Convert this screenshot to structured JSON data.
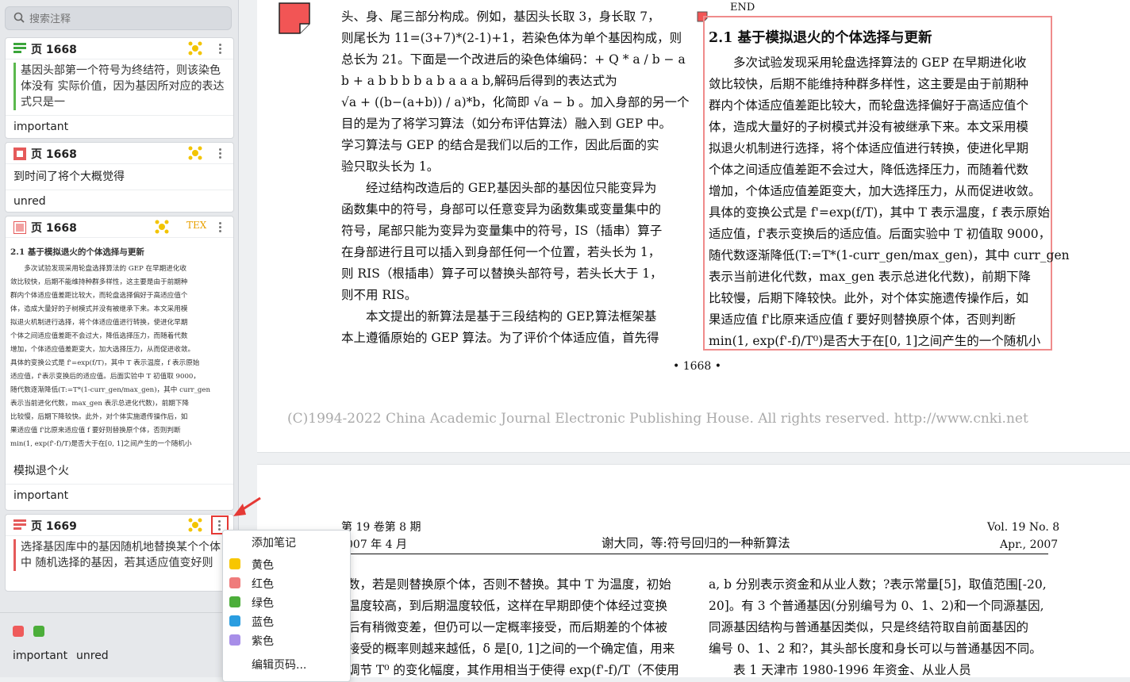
{
  "sidebar": {
    "search_placeholder": "搜索注释",
    "cards": [
      {
        "page": "页 1668",
        "quote": "基因头部第一个符号为终结符，则该染色体没有 实际价值，因为基因所对应的表达式只是一",
        "tag": "important"
      },
      {
        "page": "页 1668",
        "note": "到时间了将个大概觉得",
        "tag": "unred"
      },
      {
        "page": "页 1668",
        "tex": "TEX",
        "note": "模拟退个火",
        "tag": "important",
        "thumb_title": "2.1  基于模拟退火的个体选择与更新",
        "thumb_lines": [
          "多次试验发现采用轮盘选择算法的 GEP 在早期进化收",
          "敛比较快，后期不能维持种群多样性，这主要是由于前期种",
          "群内个体适应值差距比较大，而轮盘选择偏好于高适应值个",
          "体，造成大量好的子树模式并没有被继承下来。本文采用模",
          "拟退火机制进行选择，将个体适应值进行转换，使进化早期",
          "个体之间适应值差距不会过大，降低选择压力，而随着代数",
          "增加，个体适应值差距变大，加大选择压力，从而促进收敛。",
          "具体的变换公式是 f'=exp(f/T)，其中 T 表示温度，f 表示原始",
          "适应值，f'表示变换后的适应值。后面实验中 T 初值取 9000，",
          "随代数逐渐降低(T:=T*(1-curr_gen/max_gen)，其中 curr_gen",
          "表示当前进化代数，max_gen 表示总进化代数)，前期下降",
          "比较慢，后期下降较快。此外，对个体实施遗传操作后，如",
          "果适应值 f'比原来适应值 f 要好则替换原个体，否则判断",
          "min(1, exp(f'-f)/T)是否大于在[0, 1]之间产生的一个随机小"
        ]
      },
      {
        "page": "页 1669",
        "quote": "选择基因库中的基因随机地替换某个个体中 随机选择的基因，若其适应值变好则"
      }
    ],
    "bottom_tags": [
      "important",
      "unred"
    ]
  },
  "menu": {
    "items": [
      {
        "label": "添加笔记"
      },
      {
        "label": "黄色",
        "color": "#f7c600"
      },
      {
        "label": "红色",
        "color": "#ef7b7b"
      },
      {
        "label": "绿色",
        "color": "#4cae3a"
      },
      {
        "label": "蓝色",
        "color": "#2a9de0"
      },
      {
        "label": "紫色",
        "color": "#a78ee8"
      },
      {
        "label": "编辑页码..."
      }
    ]
  },
  "doc": {
    "left_col": [
      "头、身、尾三部分构成。例如，基因头长取 3，身长取 7，",
      "则尾长为 11=(3+7)*(2-1)+1，若染色体为单个基因构成，则",
      "总长为 21。下面是一个改进后的染色体编码：+ Q * a / b − a",
      "b + a b b b b a b a a a b,解码后得到的表达式为",
      "√a + ((b−(a+b)) / a)*b，化简即 √a − b 。加入身部的另一个",
      "目的是为了将学习算法（如分布评估算法）融入到 GEP 中。",
      "学习算法与 GEP 的结合是我们以后的工作，因此后面的实",
      "验只取头长为 1。",
      "经过结构改造后的 GEP,基因头部的基因位只能变异为",
      "函数集中的符号，身部可以任意变异为函数集或变量集中的",
      "符号，尾部只能为变异为变量集中的符号，IS（插串）算子",
      "在身部进行且可以插入到身部任何一个位置，若头长为 1，",
      "则 RIS（根插串）算子可以替换头部符号，若头长大于 1，",
      "则不用 RIS。",
      "本文提出的新算法是基于三段结构的 GEP,算法框架基",
      "本上遵循原始的 GEP 算法。为了评价个体适应值，首先得"
    ],
    "end_label": "END",
    "right_title": "2.1  基于模拟退火的个体选择与更新",
    "right_col": [
      "多次试验发现采用轮盘选择算法的 GEP 在早期进化收",
      "敛比较快，后期不能维持种群多样性，这主要是由于前期种",
      "群内个体适应值差距比较大，而轮盘选择偏好于高适应值个",
      "体，造成大量好的子树模式并没有被继承下来。本文采用模",
      "拟退火机制进行选择，将个体适应值进行转换，使进化早期",
      "个体之间适应值差距不会过大，降低选择压力，而随着代数",
      "增加，个体适应值差距变大，加大选择压力，从而促进收敛。",
      "具体的变换公式是 f'=exp(f/T)，其中 T 表示温度，f 表示原始",
      "适应值，f'表示变换后的适应值。后面实验中 T 初值取 9000，",
      "随代数逐渐降低(T:=T*(1-curr_gen/max_gen)，其中 curr_gen",
      "表示当前进化代数，max_gen 表示总进化代数)，前期下降",
      "比较慢，后期下降较快。此外，对个体实施遗传操作后，如",
      "果适应值 f'比原来适应值 f 要好则替换原个体，否则判断",
      "min(1, exp(f'-f)/T⁰)是否大于在[0, 1]之间产生的一个随机小"
    ],
    "page_number": "• 1668 •",
    "copyright": "(C)1994-2022 China Academic Journal Electronic Publishing House. All rights reserved.    http://www.cnki.net",
    "p2_header_left": "第 19 卷第 8 期",
    "p2_header_left2": "007 年 4 月",
    "p2_header_center": "谢大同，等:符号回归的一种新算法",
    "p2_header_right": "Vol. 19 No. 8",
    "p2_header_right2": "Apr., 2007",
    "p2_left": [
      "数，若是则替换原个体，否则不替换。其中 T 为温度，初始",
      "温度较高，到后期温度较低，这样在早期即使个体经过变换",
      "后有稍微变差，但仍可以一定概率接受，而后期差的个体被",
      "接受的概率则越来越低，δ 是[0, 1]之间的一个确定值，用来",
      "调节 T⁰ 的变化幅度，其作用相当于使得 exp(f'-f)/T（不使用"
    ],
    "p2_right": [
      "a, b 分别表示资金和从业人数；?表示常量[5]，取值范围[-20,",
      "20]。有 3 个普通基因(分别编号为 0、1、2)和一个同源基因,",
      "同源基因结构与普通基因类似，只是终结符取自前面基因的",
      "编号 0、1、2 和?，其头部长度和身长可以与普通基因不同。",
      "表 1   天津市 1980-1996 年资金、从业人员"
    ]
  }
}
